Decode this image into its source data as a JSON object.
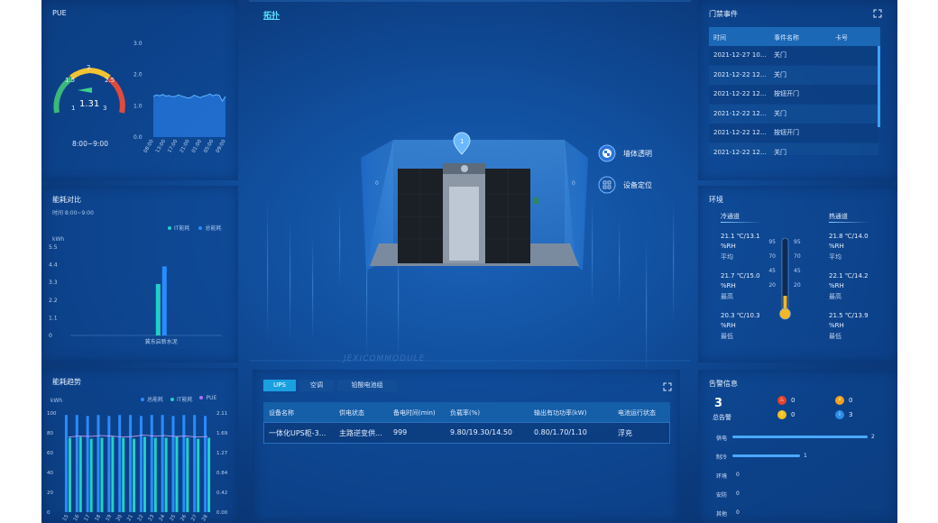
{
  "header": {
    "title": "拓扑"
  },
  "pue": {
    "title": "PUE",
    "value": "1.31",
    "gauge_value": 1.31,
    "gauge_ticks": [
      "1",
      "1.5",
      "2",
      "2.5",
      "3"
    ],
    "time_range": "8:00~9:00",
    "chart_data": {
      "type": "area",
      "ylim": [
        0,
        3.0
      ],
      "yticks": [
        "0.0",
        "1.0",
        "2.0",
        "3.0"
      ],
      "x": [
        "08:00",
        "13:00",
        "17:00",
        "21:00",
        "01:00",
        "05:00",
        "09:00"
      ],
      "y": [
        1.3,
        1.35,
        1.32,
        1.36,
        1.31,
        1.33,
        1.29,
        1.3,
        1.35,
        1.31,
        1.28,
        1.25,
        1.27,
        1.34,
        1.3,
        1.26,
        1.31,
        1.33,
        1.38,
        1.32,
        1.36,
        1.34,
        1.15,
        1.3
      ]
    }
  },
  "energy_compare": {
    "title": "能耗对比",
    "time_label": "时间 8:00~9:00",
    "unit": "kWh",
    "legend": [
      "IT能耗",
      "总能耗"
    ],
    "chart_data": {
      "type": "bar",
      "categories": [
        "冀东启新水泥"
      ],
      "series": [
        {
          "name": "IT能耗",
          "values": [
            3.2
          ],
          "color": "#22d0c8"
        },
        {
          "name": "总能耗",
          "values": [
            4.3
          ],
          "color": "#2a8cff"
        }
      ],
      "yticks": [
        "0",
        "1.1",
        "2.2",
        "3.3",
        "4.4",
        "5.5"
      ],
      "ylim": [
        0,
        5.5
      ]
    }
  },
  "energy_trend": {
    "title": "能耗趋势",
    "unit": "kWh",
    "legend": [
      "总能耗",
      "IT能耗",
      "PUE"
    ],
    "chart_data": {
      "type": "bar",
      "categories": [
        "15",
        "16",
        "17",
        "18",
        "19",
        "20",
        "21",
        "22",
        "23",
        "24",
        "25",
        "26",
        "27",
        "28"
      ],
      "series": [
        {
          "name": "总能耗",
          "values": [
            98,
            98,
            97,
            98,
            97,
            98,
            98,
            97,
            98,
            98,
            97,
            98,
            98,
            97
          ],
          "color": "#2a8cff"
        },
        {
          "name": "IT能耗",
          "values": [
            75,
            76,
            74,
            75,
            76,
            75,
            74,
            76,
            75,
            75,
            76,
            75,
            74,
            75
          ],
          "color": "#22d0c8"
        },
        {
          "name": "PUE",
          "values": [
            1.6,
            1.62,
            1.61,
            1.63,
            1.62,
            1.6,
            1.61,
            1.64,
            1.62,
            1.63,
            1.61,
            1.62,
            1.6,
            1.61
          ],
          "color": "#b36bff"
        }
      ],
      "yticks_left": [
        "0",
        "20",
        "40",
        "60",
        "80",
        "100"
      ],
      "yticks_right": [
        "0.00",
        "0.42",
        "0.84",
        "1.27",
        "1.69",
        "2.11"
      ]
    }
  },
  "room": {
    "pin_label": "1",
    "wall_marks": [
      "0",
      "0"
    ],
    "watermark": "JEXICOMMODULE"
  },
  "actions": {
    "wall_transparent": "墙体透明",
    "device_locate": "设备定位"
  },
  "access_events": {
    "title": "门禁事件",
    "columns": [
      "时间",
      "事件名称",
      "卡号"
    ],
    "rows": [
      {
        "time": "2021-12-27 10...",
        "event": "关门",
        "card": ""
      },
      {
        "time": "2021-12-22 12...",
        "event": "关门",
        "card": ""
      },
      {
        "time": "2021-12-22 12...",
        "event": "按钮开门",
        "card": ""
      },
      {
        "time": "2021-12-22 12...",
        "event": "关门",
        "card": ""
      },
      {
        "time": "2021-12-22 12...",
        "event": "按钮开门",
        "card": ""
      },
      {
        "time": "2021-12-22 12...",
        "event": "关门",
        "card": ""
      }
    ]
  },
  "environment": {
    "title": "环境",
    "cold_title": "冷通道",
    "hot_title": "热通道",
    "thermo_ticks": [
      "95",
      "70",
      "45",
      "20"
    ],
    "thermo_level": 0.2,
    "cold": [
      {
        "value": "21.1 ℃/13.1",
        "unit": "%RH",
        "label": "平均"
      },
      {
        "value": "21.7 ℃/15.0",
        "unit": "%RH",
        "label": "最高"
      },
      {
        "value": "20.3 ℃/10.3",
        "unit": "%RH",
        "label": "最低"
      }
    ],
    "hot": [
      {
        "value": "21.8 ℃/14.0",
        "unit": "%RH",
        "label": "平均"
      },
      {
        "value": "22.1 ℃/14.2",
        "unit": "%RH",
        "label": "最高"
      },
      {
        "value": "21.5 ℃/13.9",
        "unit": "%RH",
        "label": "最低"
      }
    ]
  },
  "devices": {
    "tabs": [
      "UPS",
      "空调",
      "铅酸电池组"
    ],
    "active_tab": "UPS",
    "columns": [
      "设备名称",
      "供电状态",
      "备电时间(min)",
      "负载率(%)",
      "输出有功功率(kW)",
      "电池运行状态"
    ],
    "rows": [
      {
        "name": "一体化UPS柜-3...",
        "status": "主路逆变供...",
        "backup": "999",
        "load": "9.80/19.30/14.50",
        "power": "0.80/1.70/1.10",
        "battery": "浮充"
      }
    ]
  },
  "alarms": {
    "title": "告警信息",
    "total": "3",
    "total_label": "总告警",
    "levels": [
      {
        "icon": "fire-icon",
        "color": "#e2432b",
        "count": "0"
      },
      {
        "icon": "bolt-icon",
        "color": "#f3a21c",
        "count": "0"
      },
      {
        "icon": "warning-icon",
        "color": "#f2c11d",
        "count": "0"
      },
      {
        "icon": "info-icon",
        "color": "#2e8de6",
        "count": "3"
      }
    ],
    "categories": [
      {
        "label": "供电",
        "count": "2",
        "value": 2
      },
      {
        "label": "制冷",
        "count": "1",
        "value": 1
      },
      {
        "label": "环境",
        "count": "0",
        "value": 0
      },
      {
        "label": "安防",
        "count": "0",
        "value": 0
      },
      {
        "label": "其他",
        "count": "0",
        "value": 0
      }
    ],
    "max": 2
  }
}
